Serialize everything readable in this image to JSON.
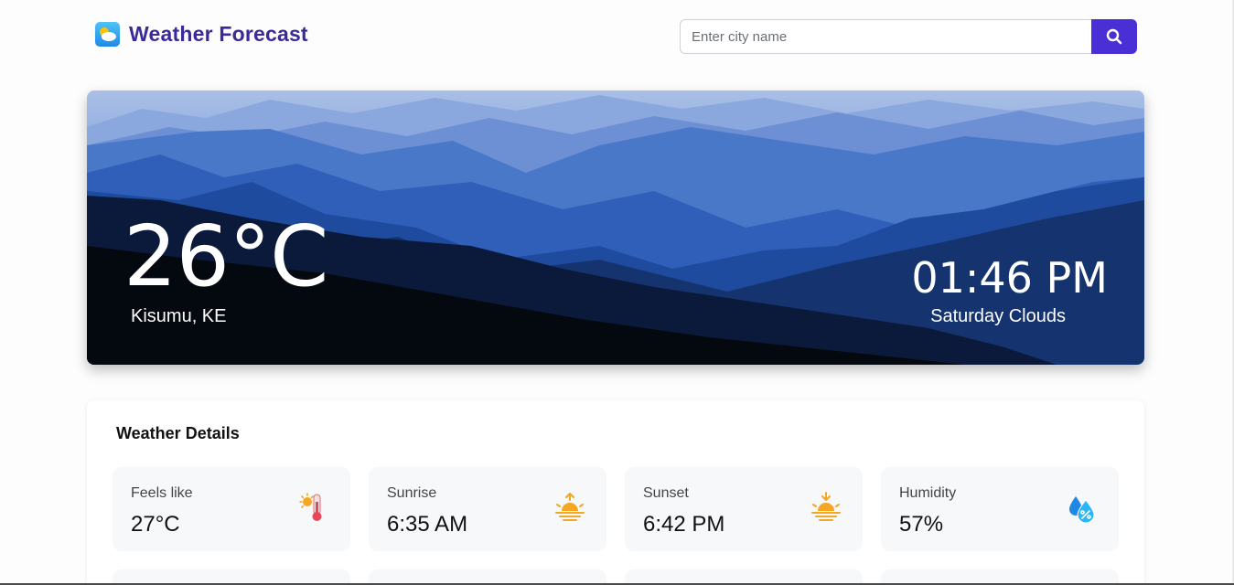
{
  "header": {
    "title": "Weather Forecast",
    "logo_icon": "weather-cloud-sun-icon"
  },
  "search": {
    "placeholder": "Enter city name",
    "value": "",
    "button_icon": "search-icon"
  },
  "current": {
    "temperature": "26°C",
    "location": "Kisumu, KE",
    "time": "01:46 PM",
    "condition": "Saturday Clouds"
  },
  "details": {
    "title": "Weather Details",
    "items": [
      {
        "label": "Feels like",
        "value": "27°C",
        "icon": "thermometer-sun-icon"
      },
      {
        "label": "Sunrise",
        "value": "6:35 AM",
        "icon": "sunrise-icon"
      },
      {
        "label": "Sunset",
        "value": "6:42 PM",
        "icon": "sunset-icon"
      },
      {
        "label": "Humidity",
        "value": "57%",
        "icon": "humidity-drops-icon"
      }
    ]
  },
  "colors": {
    "brand": "#3a2a9a",
    "accent": "#4b2fd6",
    "tile_bg": "#f7f8fa",
    "sun": "#f5a623"
  }
}
